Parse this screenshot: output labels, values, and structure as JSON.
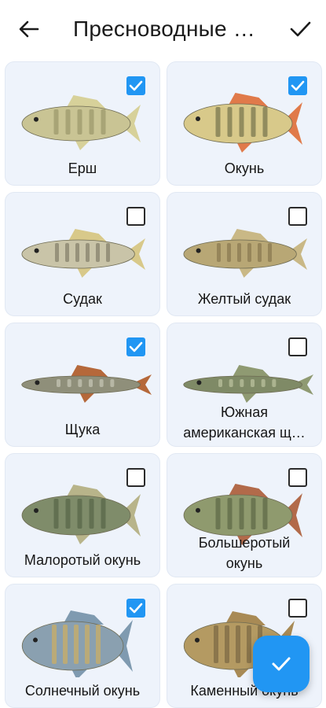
{
  "appbar": {
    "title": "Пресноводные …"
  },
  "fish": [
    {
      "label": "Ерш",
      "checked": true,
      "body": "#c9c494",
      "stripe": "#8c8a5c",
      "fin": "#d7d19a"
    },
    {
      "label": "Окунь",
      "checked": true,
      "body": "#d8c98a",
      "stripe": "#5a5a3a",
      "fin": "#e07a4a"
    },
    {
      "label": "Судак",
      "checked": false,
      "body": "#c9c4a8",
      "stripe": "#6e6a55",
      "fin": "#d8c98a"
    },
    {
      "label": "Желтый судак",
      "checked": false,
      "body": "#b8a775",
      "stripe": "#7a6a44",
      "fin": "#c9b886"
    },
    {
      "label": "Щука",
      "checked": true,
      "body": "#8f8f7a",
      "stripe": "#d8d8c8",
      "fin": "#b5683a"
    },
    {
      "label1": "Южная",
      "label2": "американская щ…",
      "checked": false,
      "body": "#7f8a66",
      "stripe": "#cfd6b0",
      "fin": "#8f9a72"
    },
    {
      "label": "Малоротый окунь",
      "checked": false,
      "body": "#7f8c6a",
      "stripe": "#4b5a3c",
      "fin": "#b8b48a"
    },
    {
      "label1": "Большеротый",
      "label2": "окунь",
      "checked": false,
      "body": "#8f9a6e",
      "stripe": "#4f5a3a",
      "fin": "#b26a4a"
    },
    {
      "label": "Солнечный окунь",
      "checked": true,
      "body": "#8aa0b0",
      "stripe": "#e2b24a",
      "fin": "#7f9ab0"
    },
    {
      "label": "Каменный окунь",
      "checked": false,
      "body": "#b49a62",
      "stripe": "#6a5a3a",
      "fin": "#a88a55"
    }
  ]
}
